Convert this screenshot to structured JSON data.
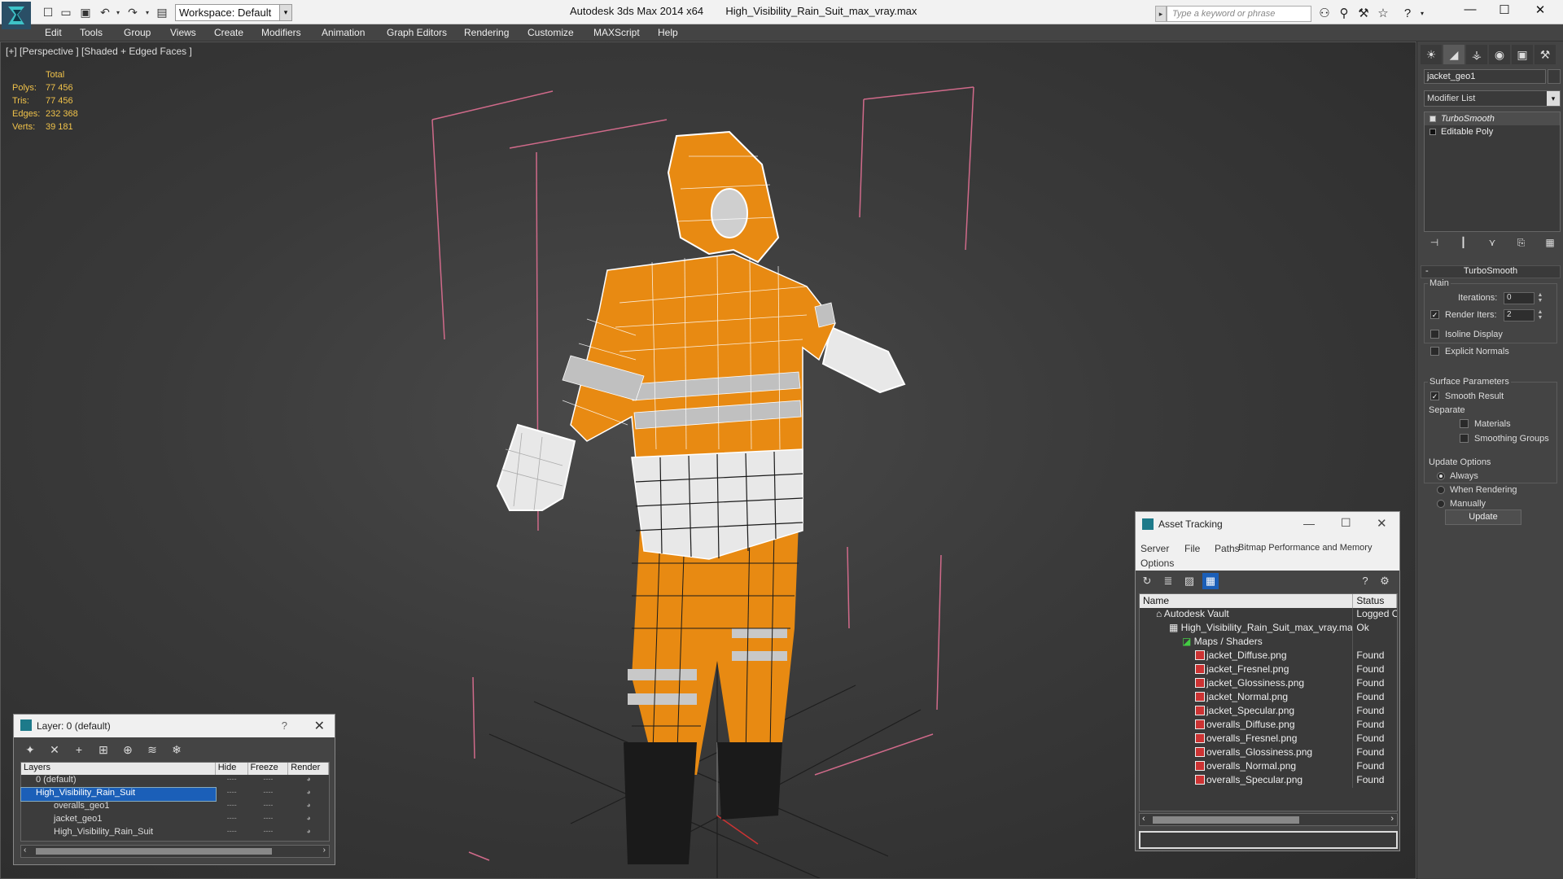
{
  "titlebar": {
    "workspace_label": "Workspace: Default",
    "app_name": "Autodesk 3ds Max",
    "app_version": "2014 x64",
    "file_name": "High_Visibility_Rain_Suit_max_vray.max",
    "search_placeholder": "Type a keyword or phrase"
  },
  "menu": [
    "Edit",
    "Tools",
    "Group",
    "Views",
    "Create",
    "Modifiers",
    "Animation",
    "Graph Editors",
    "Rendering",
    "Customize",
    "MAXScript",
    "Help"
  ],
  "viewport": {
    "label": "[+] [Perspective ] [Shaded + Edged Faces ]",
    "stats": {
      "header": "Total",
      "rows": [
        {
          "k": "Polys:",
          "v": "77 456"
        },
        {
          "k": "Tris:",
          "v": "77 456"
        },
        {
          "k": "Edges:",
          "v": "232 368"
        },
        {
          "k": "Verts:",
          "v": "39 181"
        }
      ]
    }
  },
  "command_panel": {
    "object_name": "jacket_geo1",
    "modifier_list": "Modifier List",
    "stack": [
      "TurboSmooth",
      "Editable Poly"
    ],
    "rollout_title": "TurboSmooth",
    "main_group": "Main",
    "iterations_label": "Iterations:",
    "iterations_value": "0",
    "render_iters_label": "Render Iters:",
    "render_iters_value": "2",
    "isoline_label": "Isoline Display",
    "explicit_normals_label": "Explicit Normals",
    "surface_group": "Surface Parameters",
    "smooth_result_label": "Smooth Result",
    "separate_label": "Separate",
    "materials_label": "Materials",
    "smoothing_groups_label": "Smoothing Groups",
    "update_group": "Update Options",
    "always_label": "Always",
    "when_rendering_label": "When Rendering",
    "manually_label": "Manually",
    "update_button": "Update"
  },
  "layer_dialog": {
    "title": "Layer: 0 (default)",
    "help": "?",
    "columns": [
      "Layers",
      "Hide",
      "Freeze",
      "Render"
    ],
    "rows": [
      {
        "name": "0 (default)"
      },
      {
        "name": "High_Visibility_Rain_Suit"
      },
      {
        "name": "overalls_geo1"
      },
      {
        "name": "jacket_geo1"
      },
      {
        "name": "High_Visibility_Rain_Suit"
      }
    ],
    "cell_dash": "----"
  },
  "asset_tracking": {
    "title": "Asset Tracking",
    "menu": [
      "Server",
      "File",
      "Paths",
      "Bitmap Performance and Memory",
      "Options"
    ],
    "columns": [
      "Name",
      "Status"
    ],
    "rows": [
      {
        "name": "Autodesk Vault",
        "status": "Logged Out"
      },
      {
        "name": "High_Visibility_Rain_Suit_max_vray.max",
        "status": "Ok"
      },
      {
        "name": "Maps / Shaders",
        "status": ""
      },
      {
        "name": "jacket_Diffuse.png",
        "status": "Found"
      },
      {
        "name": "jacket_Fresnel.png",
        "status": "Found"
      },
      {
        "name": "jacket_Glossiness.png",
        "status": "Found"
      },
      {
        "name": "jacket_Normal.png",
        "status": "Found"
      },
      {
        "name": "jacket_Specular.png",
        "status": "Found"
      },
      {
        "name": "overalls_Diffuse.png",
        "status": "Found"
      },
      {
        "name": "overalls_Fresnel.png",
        "status": "Found"
      },
      {
        "name": "overalls_Glossiness.png",
        "status": "Found"
      },
      {
        "name": "overalls_Normal.png",
        "status": "Found"
      },
      {
        "name": "overalls_Specular.png",
        "status": "Found"
      }
    ]
  },
  "colors": {
    "accent_blue": "#1b5fb8",
    "stats_yellow": "#f0c24a",
    "suit_orange": "#e88a12",
    "reflective_gray": "#b8b8b8",
    "bbox_pink": "#d06a8a"
  }
}
